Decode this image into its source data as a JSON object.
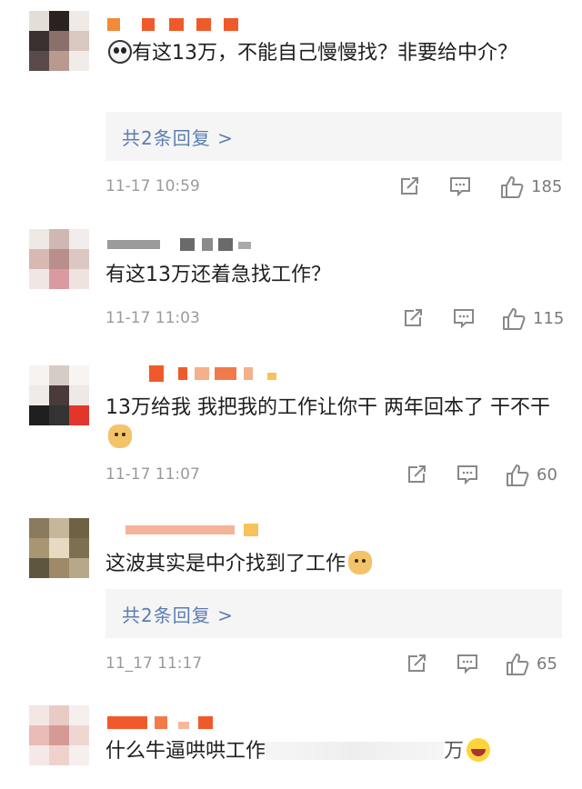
{
  "comments": [
    {
      "text": "有这13万，不能自己慢慢找？非要给中介？",
      "emoji": "panda",
      "replies": "共2条回复 >",
      "time": "11-17 10:59",
      "likes": "185"
    },
    {
      "text": "有这13万还着急找工作？",
      "time": "11-17 11:03",
      "likes": "115"
    },
    {
      "text": "13万给我 我把我的工作让你干 两年回本了 干不干",
      "emoji": "doge",
      "time": "11-17 11:07",
      "likes": "60"
    },
    {
      "text": "这波其实是中介找到了工作",
      "emoji": "doge",
      "replies": "共2条回复 >",
      "time": "11_17 11:17",
      "likes": "65"
    },
    {
      "text": "什么牛逼哄哄工作",
      "tail": "万",
      "emoji": "cry"
    }
  ],
  "icons": {
    "share": "share-icon",
    "comment": "comment-icon",
    "like": "thumbs-up-icon"
  },
  "colors": {
    "reply_link": "#5b7db1",
    "meta": "#9a9a9a",
    "reply_bg": "#f5f5f5",
    "username_pixel": "#f05a2a"
  }
}
